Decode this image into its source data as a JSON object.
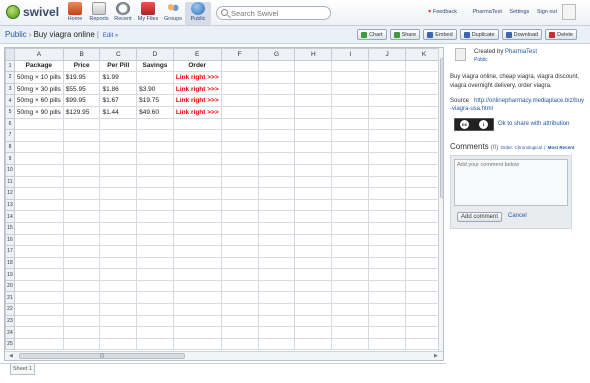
{
  "app": {
    "logo": "swivel"
  },
  "nav": [
    {
      "label": "Home",
      "icon": "house-icon"
    },
    {
      "label": "Reports",
      "icon": "reports-icon"
    },
    {
      "label": "Recent",
      "icon": "clock-icon"
    },
    {
      "label": "My Files",
      "icon": "files-icon"
    },
    {
      "label": "Groups",
      "icon": "groups-icon"
    },
    {
      "label": "Public",
      "icon": "globe-icon"
    }
  ],
  "search": {
    "placeholder": "Search Swivel"
  },
  "top_links": {
    "feedback": "Feedback",
    "user": "PharmaTest",
    "settings": "Settings",
    "signout": "Sign out"
  },
  "breadcrumb": {
    "root": "Public",
    "title": "Buy viagra online",
    "edit": "Edit »"
  },
  "actions": [
    {
      "label": "Chart",
      "color": "#3d9b3d"
    },
    {
      "label": "Share",
      "color": "#3d9b3d"
    },
    {
      "label": "Embed",
      "color": "#3a66b5"
    },
    {
      "label": "Duplicate",
      "color": "#3a66b5"
    },
    {
      "label": "Download",
      "color": "#3a66b5"
    },
    {
      "label": "Delete",
      "color": "#c03030"
    }
  ],
  "grid": {
    "columns": [
      "A",
      "B",
      "C",
      "D",
      "E",
      "F",
      "G",
      "H",
      "I",
      "J",
      "K"
    ],
    "headers": [
      "Package",
      "Price",
      "Per Pill",
      "Savings",
      "Order"
    ],
    "rows": [
      [
        "50mg × 10 pills",
        "$19.95",
        "$1.99",
        "",
        "Link right >>>"
      ],
      [
        "50mg × 30 pills",
        "$55.95",
        "$1.86",
        "$3.90",
        "Link right >>>"
      ],
      [
        "50mg × 60 pills",
        "$99.95",
        "$1.67",
        "$19.75",
        "Link right >>>"
      ],
      [
        "50mg × 90 pills",
        "$129.95",
        "$1.44",
        "$49.60",
        "Link right >>>"
      ]
    ],
    "row_count": 25
  },
  "sheet_tab": "Sheet 1",
  "sidebar": {
    "created_by_prefix": "Created by",
    "creator": "PharmaTest",
    "visibility": "Public",
    "description": "Buy viagra online, cheap viagra, viagra discount, viagra overnight delivery, order viagra.",
    "source_label": "Source",
    "source_url": "http://onlinepharmacy.mediaplace.biz/buy-viagra-usa.html",
    "license_text": "Ok to share with attribution",
    "comments_title": "Comments",
    "comments_count": "(0)",
    "order_chrono": "Order: Chronological",
    "order_sep": "|",
    "order_recent": "Most Recent",
    "comment_placeholder": "Add your comment below",
    "add_button": "Add comment",
    "cancel": "Cancel"
  },
  "colors": {
    "accent": "#2457a4",
    "link_red": "#e00000",
    "toolbar_bg": "#eaf0f7"
  }
}
